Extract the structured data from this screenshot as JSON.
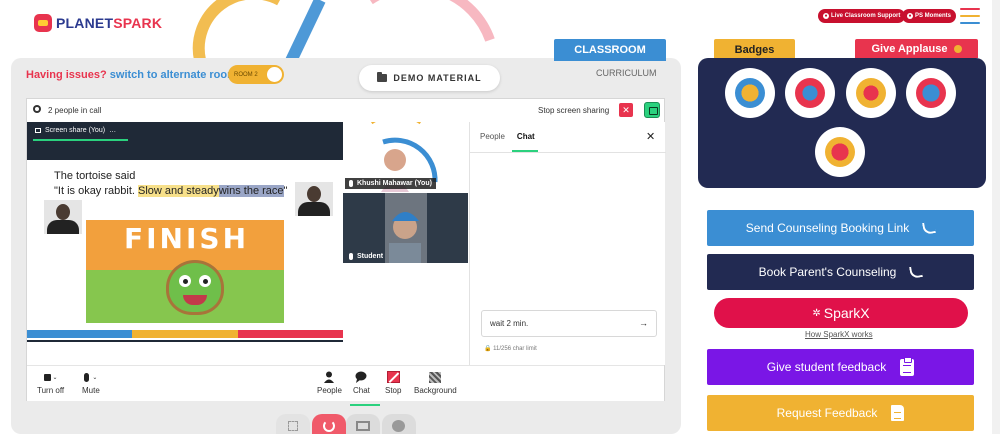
{
  "brand": {
    "logo_part1": "PLANET",
    "logo_part2": "SPARK"
  },
  "header": {
    "live_support_label": "Live Classroom Support",
    "ps_moments_label": "PS Moments"
  },
  "colors": {
    "accent_blue": "#3b8ed3",
    "accent_red": "#e8344e",
    "accent_yellow": "#f0b232",
    "navy": "#222a52",
    "green": "#2bd17e",
    "purple": "#7a16e6"
  },
  "classroom": {
    "tab_classroom": "CLASSROOM",
    "tab_curriculum": "CURRICULUM",
    "issues_text": "Having issues?",
    "alt_room_text": "switch to alternate room",
    "room_toggle_label": "ROOM 2",
    "demo_material_label": "DEMO MATERIAL"
  },
  "meeting": {
    "people_in_call": "2 people in call",
    "stop_screen_sharing": "Stop screen sharing",
    "screen_share_label": "Screen share (You)",
    "more_icon": "…"
  },
  "slide": {
    "line1": "The tortoise said",
    "line2_plain": "\"It is okay rabbit. ",
    "line2_hl1": "Slow and steady",
    "line2_hl2": "wins the race",
    "line2_end": "\"",
    "banner": "FINISH"
  },
  "participants": [
    {
      "name": "Khushi Mahawar (You)"
    },
    {
      "name": "Student"
    }
  ],
  "chat": {
    "tab_people": "People",
    "tab_chat": "Chat",
    "close_icon": "✕",
    "input_value": "wait 2 min.",
    "send_icon": "→",
    "char_limit": "11/256 char limit"
  },
  "controls": {
    "turn_off": "Turn off",
    "mute": "Mute",
    "people": "People",
    "chat": "Chat",
    "stop": "Stop",
    "background": "Background"
  },
  "right": {
    "badges_tab": "Badges",
    "applause_tab": "Give Applause",
    "send_counseling": "Send Counseling Booking Link",
    "book_parent": "Book Parent's Counseling",
    "sparkx": "SparkX",
    "sparkx_link": "How SparkX works",
    "give_feedback": "Give student feedback",
    "request_feedback": "Request Feedback"
  }
}
